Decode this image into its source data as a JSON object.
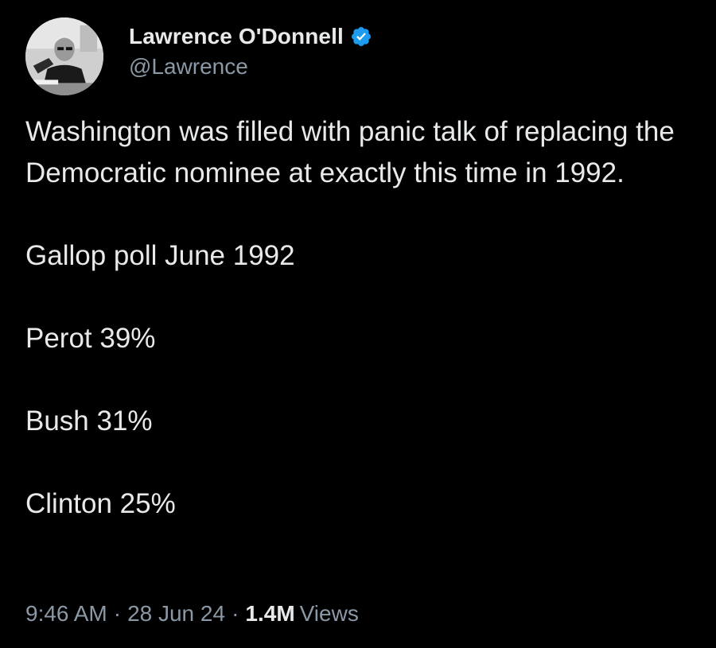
{
  "author": {
    "display_name": "Lawrence O'Donnell",
    "handle": "@Lawrence",
    "verified": true,
    "avatar_icon": "profile-photo-avatar"
  },
  "tweet": {
    "paragraphs": [
      "Washington was filled with panic talk of replacing the Democratic nominee at exactly this time in 1992.",
      "Gallop poll June 1992",
      "Perot 39%",
      "Bush 31%",
      "Clinton 25%"
    ],
    "time": "9:46 AM",
    "separator": "·",
    "date": "28 Jun 24",
    "views_count": "1.4M",
    "views_label": "Views"
  },
  "colors": {
    "background": "#000000",
    "primary_text": "#e7e9ea",
    "secondary_text": "#8b98a5",
    "verified_badge": "#1d9bf0"
  }
}
